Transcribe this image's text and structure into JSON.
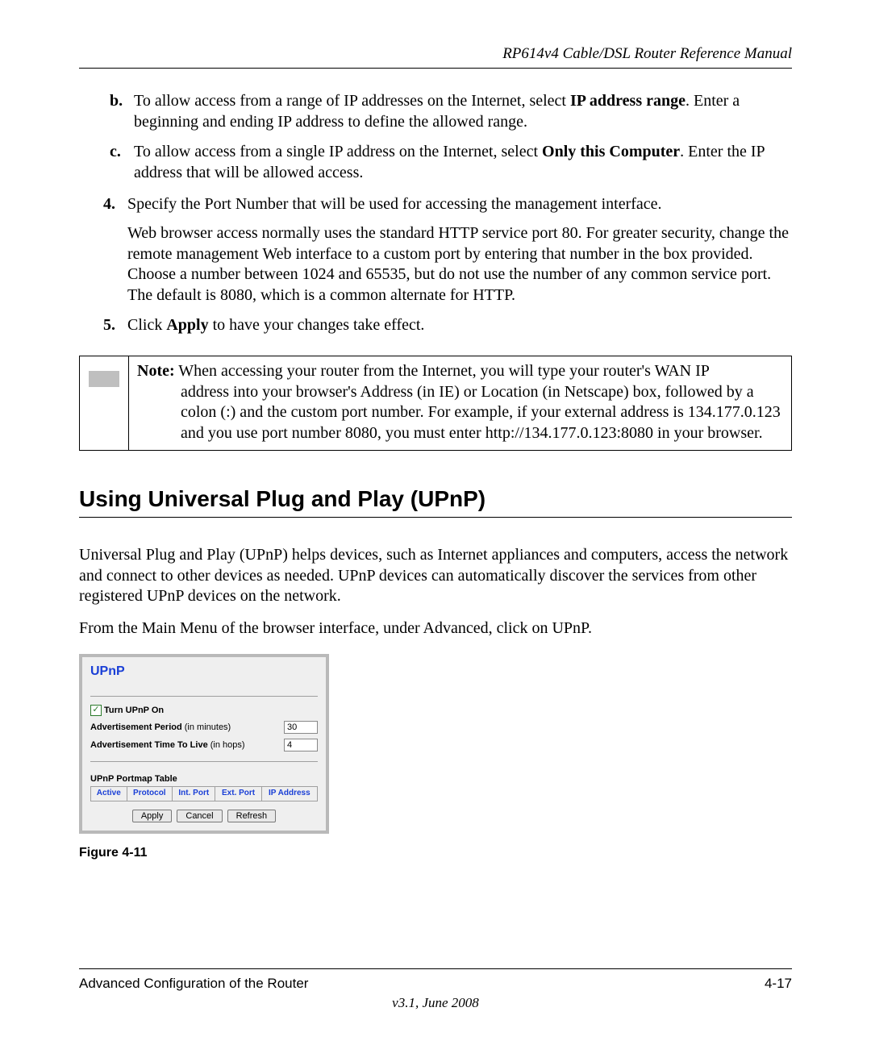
{
  "header": {
    "running_title": "RP614v4 Cable/DSL Router Reference Manual"
  },
  "content": {
    "item_b_marker": "b.",
    "item_b_text_1": "To allow access from a range of IP addresses on the Internet, select ",
    "item_b_bold": "IP address range",
    "item_b_text_2": ". Enter a beginning and ending IP address to define the allowed range.",
    "item_c_marker": "c.",
    "item_c_text_1": "To allow access from a single IP address on the Internet, select ",
    "item_c_bold": "Only this Computer",
    "item_c_text_2": ". Enter the IP address that will be allowed access.",
    "item_4_marker": "4.",
    "item_4_text": "Specify the Port Number that will be used for accessing the management interface.",
    "item_4_para": "Web browser access normally uses the standard HTTP service port 80. For greater security, change the remote management Web interface to a custom port by entering that number in the box provided. Choose a number between 1024 and 65535, but do not use the number of any common service port. The default is 8080, which is a common alternate for HTTP.",
    "item_5_marker": "5.",
    "item_5_text_1": "Click ",
    "item_5_bold": "Apply",
    "item_5_text_2": " to have your changes take effect.",
    "note_label": "Note:",
    "note_line1": " When accessing your router from the Internet, you will type your router's WAN IP",
    "note_rest": "address into your browser's Address (in IE) or Location (in Netscape) box, followed by a colon (:) and the custom port number. For example, if your external address is 134.177.0.123 and you use port number 8080, you must enter http://134.177.0.123:8080 in your browser.",
    "section_heading": "Using Universal Plug and Play (UPnP)",
    "upnp_intro": "Universal Plug and Play (UPnP) helps devices, such as Internet appliances and computers, access the network and connect to other devices as needed. UPnP devices can automatically discover the services from other registered UPnP devices on the network.",
    "upnp_nav": "From the Main Menu of the browser interface, under Advanced, click on UPnP."
  },
  "upnp_panel": {
    "title": "UPnP",
    "turn_on_label": "Turn UPnP On",
    "ad_period_label": "Advertisement Period",
    "ad_period_unit": " (in minutes)",
    "ad_period_value": "30",
    "ttl_label": "Advertisement Time To Live",
    "ttl_unit": " (in hops)",
    "ttl_value": "4",
    "portmap_heading": "UPnP Portmap Table",
    "cols": {
      "active": "Active",
      "protocol": "Protocol",
      "int_port": "Int. Port",
      "ext_port": "Ext. Port",
      "ip": "IP Address"
    },
    "buttons": {
      "apply": "Apply",
      "cancel": "Cancel",
      "refresh": "Refresh"
    }
  },
  "figure_caption": "Figure 4-11",
  "footer": {
    "left": "Advanced Configuration of the Router",
    "right": "4-17",
    "version": "v3.1, June 2008"
  }
}
